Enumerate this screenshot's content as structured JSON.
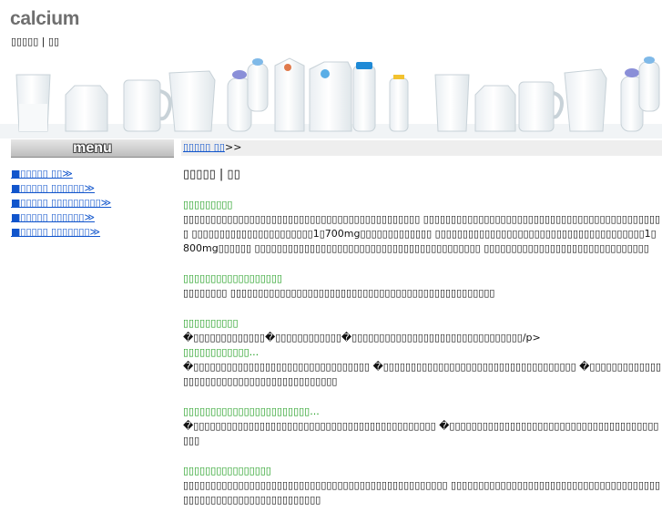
{
  "header": {
    "logo": "calcium",
    "subtitle": "▯▯▯▯▯ | ▯▯"
  },
  "menu": {
    "title": "menu",
    "items": [
      "■▯▯▯▯▯ ▯▯≫",
      "■▯▯▯▯▯ ▯▯▯▯▯▯≫",
      "■▯▯▯▯▯ ▯▯▯▯▯▯▯▯▯≫",
      "■▯▯▯▯▯ ▯▯▯▯▯▯≫",
      "■▯▯▯▯▯ ▯▯▯▯▯▯▯≫"
    ]
  },
  "breadcrumb": {
    "link": "▯▯▯▯▯ ▯▯",
    "separator": ">>"
  },
  "main": {
    "title": "▯▯▯▯▯ | ▯▯",
    "sections": [
      {
        "heading": "▯▯▯▯▯▯▯▯▯",
        "body": "▯▯▯▯▯▯▯▯▯▯▯▯▯▯▯▯▯▯▯▯▯▯▯▯▯▯▯▯▯▯▯▯▯▯▯▯▯▯▯▯▯▯▯ ▯▯▯▯▯▯▯▯▯▯▯▯▯▯▯▯▯▯▯▯▯▯▯▯▯▯▯▯▯▯▯▯▯▯▯▯▯▯▯▯▯▯▯▯ ▯▯▯▯▯▯▯▯▯▯▯▯▯▯▯▯▯▯▯▯▯▯1▯700mg▯▯▯▯▯▯▯▯▯▯▯▯▯ ▯▯▯▯▯▯▯▯▯▯▯▯▯▯▯▯▯▯▯▯▯▯▯▯▯▯▯▯▯▯▯▯▯▯▯▯▯▯1▯800mg▯▯▯▯▯▯ ▯▯▯▯▯▯▯▯▯▯▯▯▯▯▯▯▯▯▯▯▯▯▯▯▯▯▯▯▯▯▯▯▯▯▯▯▯▯▯▯▯ ▯▯▯▯▯▯▯▯▯▯▯▯▯▯▯▯▯▯▯▯▯▯▯▯▯▯▯▯▯▯"
      },
      {
        "heading": "▯▯▯▯▯▯▯▯▯▯▯▯▯▯▯▯▯▯",
        "body": "▯▯▯▯▯▯▯▯ ▯▯▯▯▯▯▯▯▯▯▯▯▯▯▯▯▯▯▯▯▯▯▯▯▯▯▯▯▯▯▯▯▯▯▯▯▯▯▯▯▯▯▯▯▯▯▯▯"
      },
      {
        "heading": "▯▯▯▯▯▯▯▯▯▯",
        "body": "�▯▯▯▯▯▯▯▯▯▯▯▯▯�▯▯▯▯▯▯▯▯▯▯▯▯�▯▯▯▯▯▯▯▯▯▯▯▯▯▯▯▯▯▯▯▯▯▯▯▯▯▯▯▯▯▯▯/p>"
      },
      {
        "heading": "▯▯▯▯▯▯▯▯▯▯▯▯...",
        "body": "�▯▯▯▯▯▯▯▯▯▯▯▯▯▯▯▯▯▯▯▯▯▯▯▯▯▯▯▯▯▯▯▯ �▯▯▯▯▯▯▯▯▯▯▯▯▯▯▯▯▯▯▯▯▯▯▯▯▯▯▯▯▯▯▯▯▯▯▯ �▯▯▯▯▯▯▯▯▯▯▯▯▯▯▯▯▯▯▯▯▯▯▯▯▯▯▯▯▯▯▯▯▯▯▯▯▯▯▯▯▯"
      },
      {
        "heading": "▯▯▯▯▯▯▯▯▯▯▯▯▯▯▯▯▯▯▯▯▯▯▯...",
        "body": "�▯▯▯▯▯▯▯▯▯▯▯▯▯▯▯▯▯▯▯▯▯▯▯▯▯▯▯▯▯▯▯▯▯▯▯▯▯▯▯▯▯▯▯▯ �▯▯▯▯▯▯▯▯▯▯▯▯▯▯▯▯▯▯▯▯▯▯▯▯▯▯▯▯▯▯▯▯▯▯▯▯▯▯▯▯▯"
      },
      {
        "heading": "▯▯▯▯▯▯▯▯▯▯▯▯▯▯▯▯",
        "body": "▯▯▯▯▯▯▯▯▯▯▯▯▯▯▯▯▯▯▯▯▯▯▯▯▯▯▯▯▯▯▯▯▯▯▯▯▯▯▯▯▯▯▯▯▯▯▯▯ ▯▯▯▯▯▯▯▯▯▯▯▯▯▯▯▯▯▯▯▯▯▯▯▯▯▯▯▯▯▯▯▯▯▯▯▯▯▯▯▯▯▯▯▯▯▯▯▯▯▯▯▯▯▯▯▯▯▯▯▯▯▯▯"
      }
    ]
  },
  "colors": {
    "link": "#1155cc",
    "heading_green": "#1c9c1c",
    "breadcrumb_bg": "#eeeeee",
    "logo": "#6f6f6f"
  }
}
